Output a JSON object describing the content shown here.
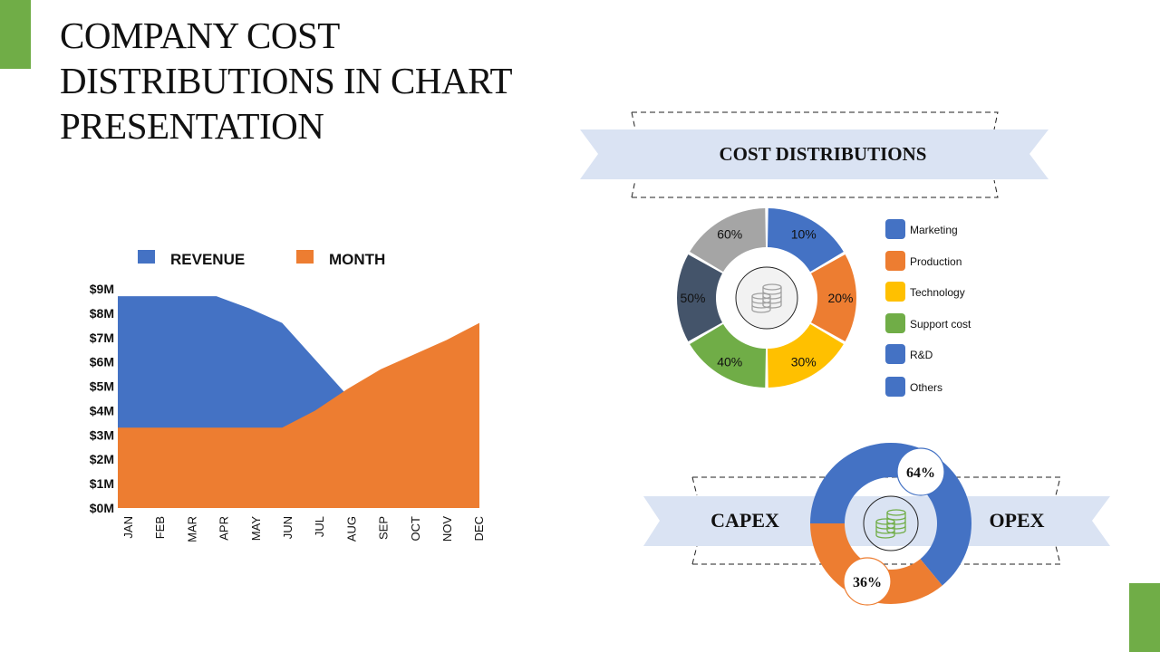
{
  "slide": {
    "title": "COMPANY COST DISTRIBUTIONS IN CHART PRESENTATION",
    "accent_color": "#70ad47"
  },
  "chart_data": [
    {
      "type": "area",
      "title": "",
      "xlabel": "",
      "ylabel": "",
      "categories": [
        "JAN",
        "FEB",
        "MAR",
        "APR",
        "MAY",
        "JUN",
        "JUL",
        "AUG",
        "SEP",
        "OCT",
        "NOV",
        "DEC"
      ],
      "yticks": [
        "$0M",
        "$1M",
        "$2M",
        "$3M",
        "$4M",
        "$5M",
        "$6M",
        "$7M",
        "$8M",
        "$9M"
      ],
      "ylim": [
        0,
        9
      ],
      "grid": false,
      "legend": "top",
      "series": [
        {
          "name": "REVENUE",
          "color": "#4472c4",
          "values": [
            8.7,
            8.7,
            8.7,
            8.7,
            8.2,
            7.6,
            6.1,
            4.6,
            3.0,
            3.0,
            3.0,
            3.0
          ]
        },
        {
          "name": "MONTH",
          "color": "#ed7d31",
          "values": [
            3.3,
            3.3,
            3.3,
            3.3,
            3.3,
            3.3,
            4.0,
            4.9,
            5.7,
            6.3,
            6.9,
            7.6
          ]
        }
      ]
    },
    {
      "type": "pie",
      "variant": "donut",
      "title": "COST DISTRIBUTIONS",
      "slices": [
        {
          "label": "Marketing",
          "value_label": "10%",
          "share": 1,
          "color": "#4472c4"
        },
        {
          "label": "Production",
          "value_label": "20%",
          "share": 1,
          "color": "#ed7d31"
        },
        {
          "label": "Technology",
          "value_label": "30%",
          "share": 1,
          "color": "#ffc000"
        },
        {
          "label": "Support cost",
          "value_label": "40%",
          "share": 1,
          "color": "#70ad47"
        },
        {
          "label": "R&D",
          "value_label": "50%",
          "share": 1,
          "color": "#44546a"
        },
        {
          "label": "Others",
          "value_label": "60%",
          "share": 1,
          "color": "#a5a5a5"
        }
      ],
      "legend": [
        {
          "label": "Marketing",
          "color": "#4472c4"
        },
        {
          "label": "Production",
          "color": "#ed7d31"
        },
        {
          "label": "Technology",
          "color": "#ffc000"
        },
        {
          "label": "Support cost",
          "color": "#70ad47"
        },
        {
          "label": "R&D",
          "color": "#4472c4"
        },
        {
          "label": "Others",
          "color": "#4472c4"
        }
      ],
      "legend_position": "right",
      "center_icon": "coins-icon"
    },
    {
      "type": "pie",
      "variant": "donut",
      "title": "",
      "left_label": "CAPEX",
      "right_label": "OPEX",
      "slices": [
        {
          "label": "OPEX",
          "value": 64,
          "value_label": "64%",
          "color": "#4472c4"
        },
        {
          "label": "CAPEX",
          "value": 36,
          "value_label": "36%",
          "color": "#ed7d31"
        }
      ],
      "center_icon": "coins-icon"
    }
  ],
  "banner_color": "#dae3f3"
}
